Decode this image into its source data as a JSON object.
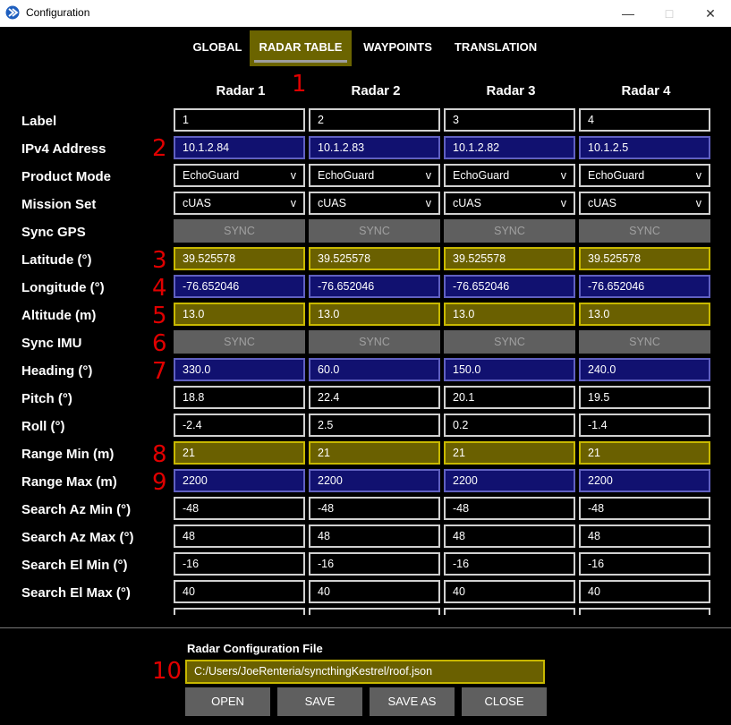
{
  "window": {
    "title": "Configuration",
    "min_icon": "minimize-icon",
    "max_icon": "maximize-icon",
    "close_icon": "close-icon"
  },
  "tabs": [
    {
      "label": "GLOBAL",
      "active": false
    },
    {
      "label": "RADAR TABLE",
      "active": true
    },
    {
      "label": "WAYPOINTS",
      "active": false
    },
    {
      "label": "TRANSLATION",
      "active": false
    }
  ],
  "callouts": [
    "1",
    "2",
    "3",
    "4",
    "5",
    "6",
    "7",
    "8",
    "9",
    "10"
  ],
  "colors": {
    "highlight_yellow": "#6a6000",
    "highlight_blue": "#111170",
    "sync_gray": "#5f5f5f",
    "callout_red": "#e00000"
  },
  "columns": [
    "Radar 1",
    "Radar 2",
    "Radar 3",
    "Radar 4"
  ],
  "rows": [
    {
      "label": "Label",
      "style": "plain",
      "kind": "text",
      "values": [
        "1",
        "2",
        "3",
        "4"
      ]
    },
    {
      "label": "IPv4 Address",
      "style": "blue",
      "kind": "text",
      "values": [
        "10.1.2.84",
        "10.1.2.83",
        "10.1.2.82",
        "10.1.2.5"
      ]
    },
    {
      "label": "Product Mode",
      "style": "plain",
      "kind": "select",
      "values": [
        "EchoGuard",
        "EchoGuard",
        "EchoGuard",
        "EchoGuard"
      ]
    },
    {
      "label": "Mission Set",
      "style": "plain",
      "kind": "select",
      "values": [
        "cUAS",
        "cUAS",
        "cUAS",
        "cUAS"
      ]
    },
    {
      "label": "Sync GPS",
      "style": "sync",
      "kind": "button",
      "values": [
        "SYNC",
        "SYNC",
        "SYNC",
        "SYNC"
      ]
    },
    {
      "label": "Latitude (°)",
      "style": "yellow",
      "kind": "text",
      "values": [
        "39.525578",
        "39.525578",
        "39.525578",
        "39.525578"
      ]
    },
    {
      "label": "Longitude (°)",
      "style": "blue",
      "kind": "text",
      "values": [
        "-76.652046",
        "-76.652046",
        "-76.652046",
        "-76.652046"
      ]
    },
    {
      "label": "Altitude (m)",
      "style": "yellow",
      "kind": "text",
      "values": [
        "13.0",
        "13.0",
        "13.0",
        "13.0"
      ]
    },
    {
      "label": "Sync IMU",
      "style": "sync",
      "kind": "button",
      "values": [
        "SYNC",
        "SYNC",
        "SYNC",
        "SYNC"
      ]
    },
    {
      "label": "Heading (°)",
      "style": "blue",
      "kind": "text",
      "values": [
        "330.0",
        "60.0",
        "150.0",
        "240.0"
      ]
    },
    {
      "label": "Pitch (°)",
      "style": "plain",
      "kind": "text",
      "values": [
        "18.8",
        "22.4",
        "20.1",
        "19.5"
      ]
    },
    {
      "label": "Roll (°)",
      "style": "plain",
      "kind": "text",
      "values": [
        "-2.4",
        "2.5",
        "0.2",
        "-1.4"
      ]
    },
    {
      "label": "Range Min (m)",
      "style": "yellow",
      "kind": "text",
      "values": [
        "21",
        "21",
        "21",
        "21"
      ]
    },
    {
      "label": "Range Max (m)",
      "style": "blue",
      "kind": "text",
      "values": [
        "2200",
        "2200",
        "2200",
        "2200"
      ]
    },
    {
      "label": "Search Az Min (°)",
      "style": "plain",
      "kind": "text",
      "values": [
        "-48",
        "-48",
        "-48",
        "-48"
      ]
    },
    {
      "label": "Search Az Max (°)",
      "style": "plain",
      "kind": "text",
      "values": [
        "48",
        "48",
        "48",
        "48"
      ]
    },
    {
      "label": "Search El Min (°)",
      "style": "plain",
      "kind": "text",
      "values": [
        "-16",
        "-16",
        "-16",
        "-16"
      ]
    },
    {
      "label": "Search El Max (°)",
      "style": "plain",
      "kind": "text",
      "values": [
        "40",
        "40",
        "40",
        "40"
      ]
    }
  ],
  "select_arrow": "v",
  "file": {
    "label": "Radar Configuration File",
    "path": "C:/Users/JoeRenteria/syncthingKestrel/roof.json"
  },
  "buttons": [
    "OPEN",
    "SAVE",
    "SAVE AS",
    "CLOSE"
  ]
}
